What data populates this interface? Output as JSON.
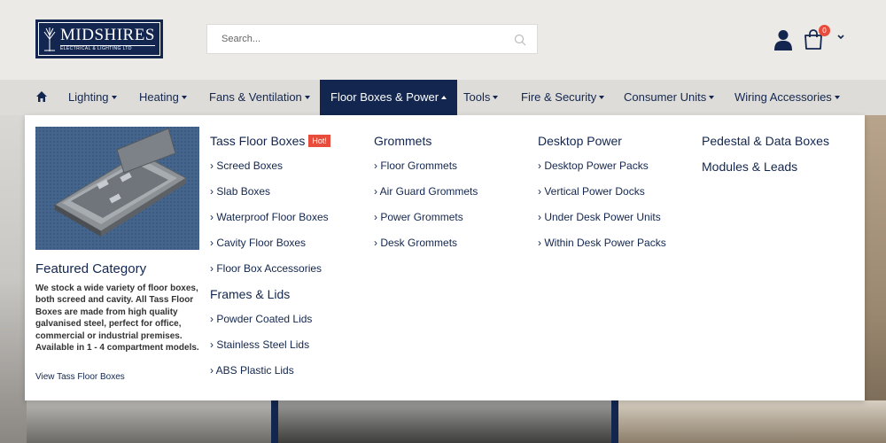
{
  "logo": {
    "main": "MIDSHIRES",
    "sub": "ELECTRICAL & LIGHTING LTD"
  },
  "search": {
    "placeholder": "Search..."
  },
  "cart": {
    "count": "0"
  },
  "nav": {
    "items": [
      {
        "label": "Lighting"
      },
      {
        "label": "Heating"
      },
      {
        "label": "Fans & Ventilation"
      },
      {
        "label": "Floor Boxes & Power"
      },
      {
        "label": "Tools"
      },
      {
        "label": "Fire & Security"
      },
      {
        "label": "Consumer Units"
      },
      {
        "label": "Wiring Accessories"
      }
    ]
  },
  "featured": {
    "title": "Featured Category",
    "description": "We stock a wide variety of floor boxes, both screed and cavity. All Tass Floor Boxes are made from high quality galvanised steel, perfect for office, commercial or industrial premises. Available in 1 - 4 compartment models.",
    "link": "View Tass Floor Boxes"
  },
  "menu": {
    "col1": {
      "heading": "Tass Floor Boxes",
      "badge": "Hot!",
      "links": [
        "Screed Boxes",
        "Slab Boxes",
        "Waterproof Floor Boxes",
        "Cavity Floor Boxes",
        "Floor Box Accessories"
      ],
      "heading2": "Frames & Lids",
      "links2": [
        "Powder Coated Lids",
        "Stainless Steel Lids",
        "ABS Plastic Lids"
      ]
    },
    "col2": {
      "heading": "Grommets",
      "links": [
        "Floor Grommets",
        "Air Guard Grommets",
        "Power Grommets",
        "Desk Grommets"
      ]
    },
    "col3": {
      "heading": "Desktop Power",
      "links": [
        "Desktop Power Packs",
        "Vertical Power Docks",
        "Under Desk Power Units",
        "Within Desk Power Packs"
      ]
    },
    "col4": {
      "heading": "Pedestal & Data Boxes",
      "heading2": "Modules & Leads"
    }
  }
}
